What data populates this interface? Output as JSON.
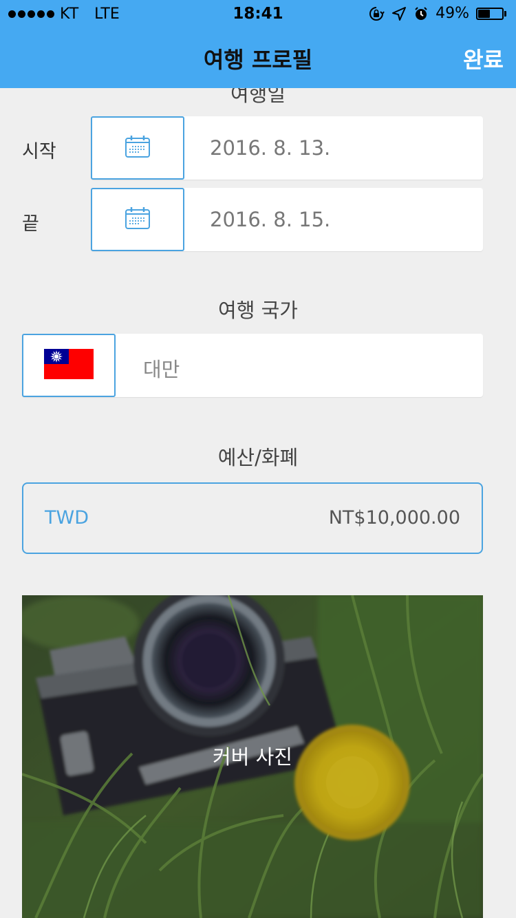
{
  "status_bar": {
    "carrier": "KT",
    "network": "LTE",
    "time": "18:41",
    "battery_text": "49%",
    "battery_level": 0.49,
    "icons": [
      "signal-dots-icon",
      "orientation-lock-icon",
      "location-arrow-icon",
      "alarm-icon",
      "battery-icon"
    ]
  },
  "nav": {
    "title": "여행 프로필",
    "done_label": "완료"
  },
  "dates": {
    "section_title": "여행일",
    "start_label": "시작",
    "start_value": "2016. 8. 13.",
    "end_label": "끝",
    "end_value": "2016. 8. 15.",
    "icon": "calendar-icon"
  },
  "country": {
    "section_title": "여행 국가",
    "value": "대만",
    "icon": "taiwan-flag-icon"
  },
  "budget": {
    "section_title": "예산/화폐",
    "currency_code": "TWD",
    "amount": "NT$10,000.00"
  },
  "cover": {
    "caption": "커버 사진",
    "image": "camera-and-dandelion-photo"
  },
  "colors": {
    "nav_background": "#45a9f2",
    "accent": "#4aa3e0",
    "page_background": "#efefef"
  }
}
